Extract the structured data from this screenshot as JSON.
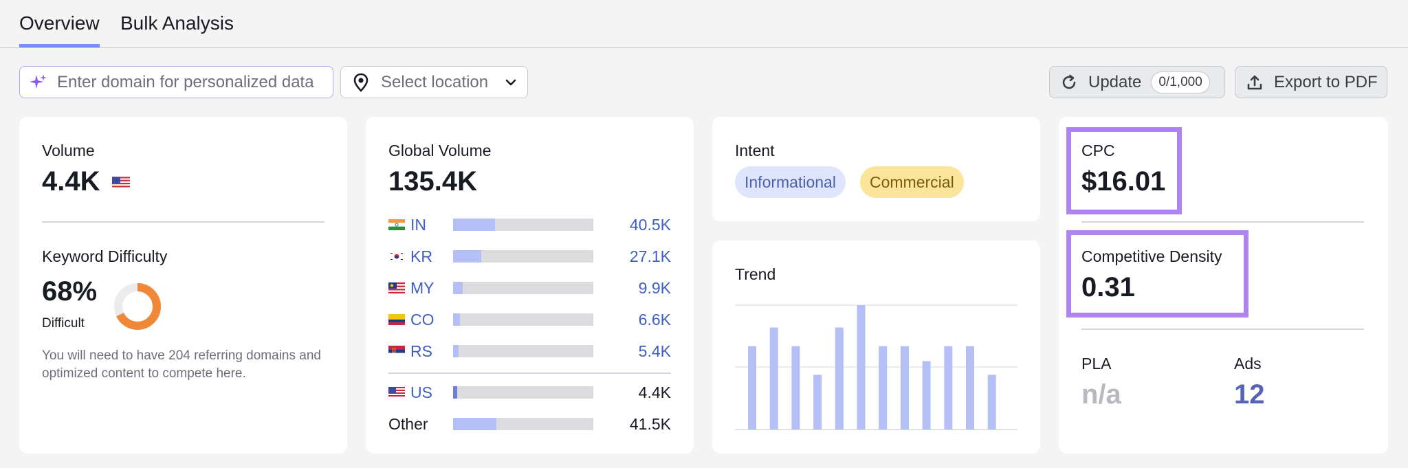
{
  "tabs": [
    {
      "label": "Overview",
      "active": true
    },
    {
      "label": "Bulk Analysis",
      "active": false
    }
  ],
  "toolbar": {
    "domain_placeholder": "Enter domain for personalized data",
    "location_label": "Select location",
    "update_label": "Update",
    "update_quota": "0/1,000",
    "export_label": "Export to PDF"
  },
  "volume": {
    "label": "Volume",
    "value": "4.4K",
    "flag": "US"
  },
  "keyword_difficulty": {
    "label": "Keyword Difficulty",
    "value": "68%",
    "percent": 68,
    "level": "Difficult",
    "description": "You will need to have 204 referring domains and optimized content to compete here.",
    "color": "#f0883a"
  },
  "global_volume": {
    "label": "Global Volume",
    "value": "135.4K",
    "countries": [
      {
        "code": "IN",
        "value": "40.5K",
        "share": 0.3
      },
      {
        "code": "KR",
        "value": "27.1K",
        "share": 0.2
      },
      {
        "code": "MY",
        "value": "9.9K",
        "share": 0.07
      },
      {
        "code": "CO",
        "value": "6.6K",
        "share": 0.05
      },
      {
        "code": "RS",
        "value": "5.4K",
        "share": 0.04
      }
    ],
    "us": {
      "code": "US",
      "value": "4.4K",
      "share": 0.03
    },
    "other": {
      "label": "Other",
      "value": "41.5K",
      "share": 0.31
    }
  },
  "intent": {
    "label": "Intent",
    "tags": [
      "Informational",
      "Commercial"
    ]
  },
  "trend": {
    "label": "Trend",
    "values": [
      0.67,
      0.82,
      0.67,
      0.44,
      0.82,
      1.0,
      0.67,
      0.67,
      0.55,
      0.67,
      0.67,
      0.44
    ]
  },
  "cpc": {
    "label": "CPC",
    "value": "$16.01"
  },
  "competitive_density": {
    "label": "Competitive Density",
    "value": "0.31"
  },
  "pla": {
    "label": "PLA",
    "value": "n/a"
  },
  "ads": {
    "label": "Ads",
    "value": "12"
  },
  "colors": {
    "accent": "#7b8ef1",
    "highlight": "#b084f0",
    "bar_fill": "#b4c0f5",
    "link": "#3e5fbf"
  }
}
